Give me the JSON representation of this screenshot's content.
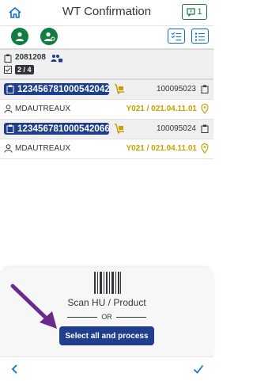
{
  "header": {
    "title": "WT Confirmation",
    "message_count": "1"
  },
  "colors": {
    "accent": "#1f3e8c",
    "positive": "#107e3e",
    "bin": "#c8a100"
  },
  "warehouse_task": {
    "number": "2081208",
    "progress": "2 / 4"
  },
  "items": [
    {
      "hu": "123456781000542042",
      "doc": "100095023",
      "user": "MDAUTREAUX",
      "bin": "Y021 / 021.04.11.01"
    },
    {
      "hu": "123456781000542066",
      "doc": "100095024",
      "user": "MDAUTREAUX",
      "bin": "Y021 / 021.04.11.01"
    }
  ],
  "sheet": {
    "scan_label": "Scan HU / Product",
    "or_label": "OR",
    "button_label": "Select all and process"
  },
  "icons": [
    "home-icon",
    "message-icon",
    "user-icon",
    "user-settings-icon",
    "checklist-icon",
    "list-icon",
    "clipboard-icon",
    "users-lock-icon",
    "hand-truck-icon",
    "person-icon",
    "location-pin-icon",
    "barcode-icon",
    "back-icon",
    "check-icon",
    "arrow-icon"
  ]
}
